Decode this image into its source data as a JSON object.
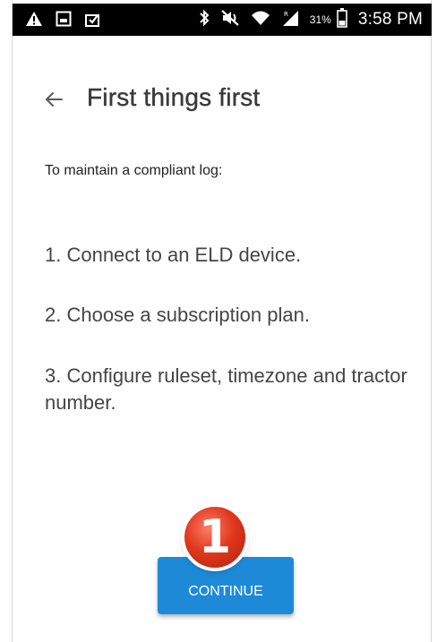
{
  "status_bar": {
    "left_icons": [
      "warning-icon",
      "image-icon",
      "clipboard-icon"
    ],
    "right_icons": [
      "bluetooth-icon",
      "mute-icon",
      "wifi-icon",
      "signal-icon",
      "battery-icon"
    ],
    "battery_percent": "31%",
    "time": "3:58 PM"
  },
  "header": {
    "back_icon": "back-arrow-icon",
    "title": "First things first"
  },
  "content": {
    "intro": "To maintain a compliant log:",
    "steps": [
      "1. Connect to an ELD device.",
      "2. Choose a subscription plan.",
      "3. Configure ruleset, timezone and tractor number."
    ]
  },
  "annotation": {
    "number": "1",
    "color": "#e0391f"
  },
  "actions": {
    "continue_label": "CONTINUE",
    "continue_color": "#1d8ad8"
  }
}
